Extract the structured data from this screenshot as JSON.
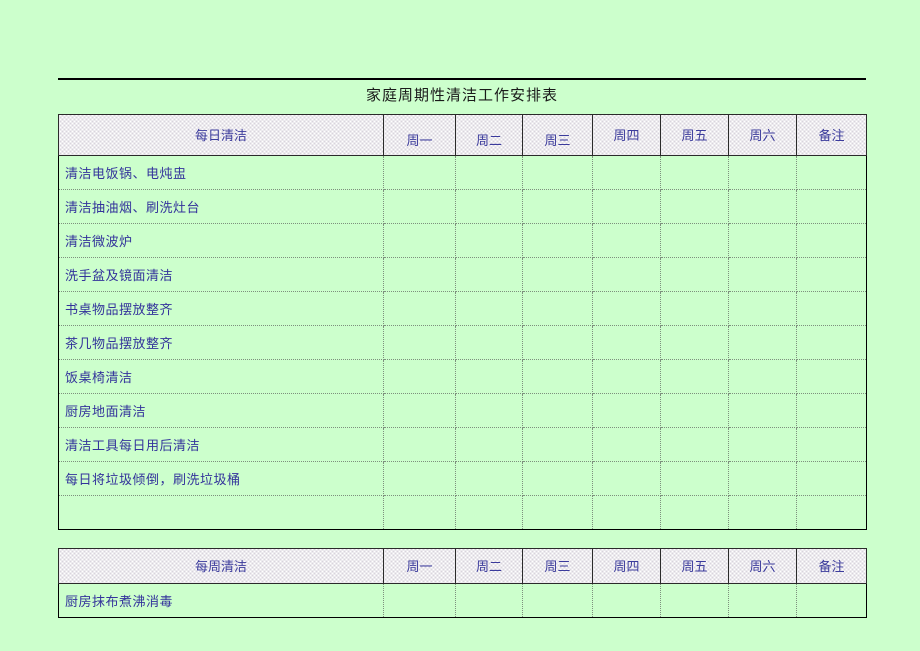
{
  "document": {
    "title": "家庭周期性清洁工作安排表",
    "background_color": "#ccffcc",
    "text_color": "#33339b",
    "title_color": "#1a1a1a",
    "header_fill": "#e8e4ec"
  },
  "tables": [
    {
      "name": "daily-cleaning-table",
      "category_header": "每日清洁",
      "columns": [
        "周一",
        "周二",
        "周三",
        "周四",
        "周五",
        "周六",
        "备注"
      ],
      "rows": [
        "清洁电饭锅、电炖盅",
        "清洁抽油烟、刷洗灶台",
        "清洁微波炉",
        "洗手盆及镜面清洁",
        "书桌物品摆放整齐",
        "茶几物品摆放整齐",
        "饭桌椅清洁",
        "厨房地面清洁",
        "清洁工具每日用后清洁",
        "每日将垃圾倾倒，刷洗垃圾桶",
        ""
      ]
    },
    {
      "name": "weekly-cleaning-table",
      "category_header": "每周清洁",
      "columns": [
        "周一",
        "周二",
        "周三",
        "周四",
        "周五",
        "周六",
        "备注"
      ],
      "rows": [
        "厨房抹布煮沸消毒"
      ]
    }
  ]
}
